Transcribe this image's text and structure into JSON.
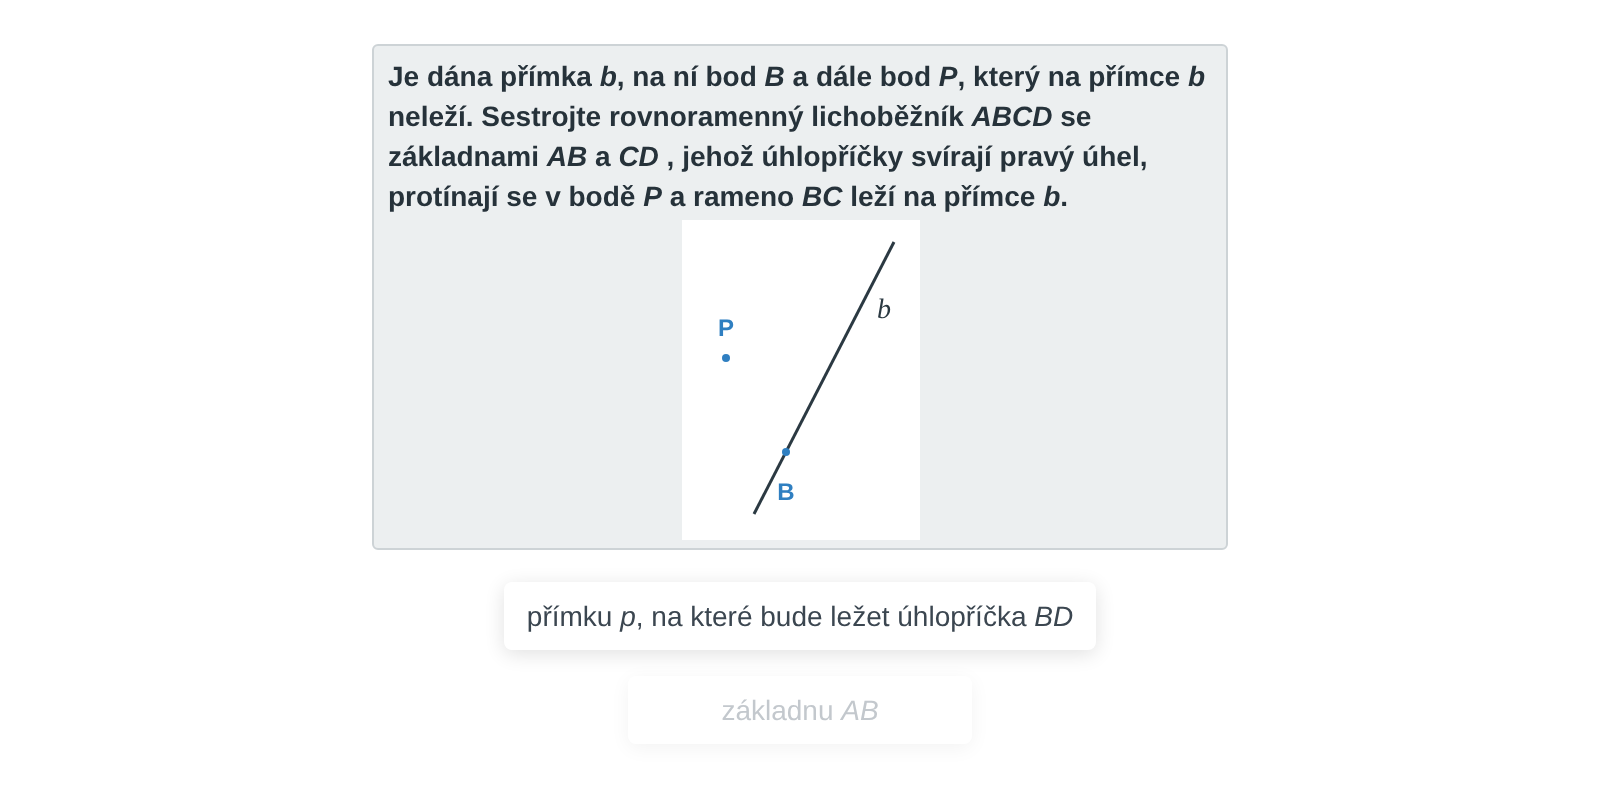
{
  "problem": {
    "text": "Je dána přímka *b*, na ní bod *B* a dále bod *P*, který na přímce *b* neleží. Sestrojte rovnoramenný lichoběžník *ABCD* se základnami *AB* a *CD* , jehož úhlopříčky svírají pravý úhel, protínají se v bodě *P* a rameno *BC* leží na přímce *b*.",
    "figure": {
      "points": [
        {
          "label": "P"
        },
        {
          "label": "B"
        }
      ],
      "line_label": "b"
    }
  },
  "options": [
    {
      "text": "přímku *p*, na které bude ležet úhlopříčka *BD*",
      "dimmed": false
    },
    {
      "text": "základnu *AB*",
      "dimmed": true
    }
  ]
}
